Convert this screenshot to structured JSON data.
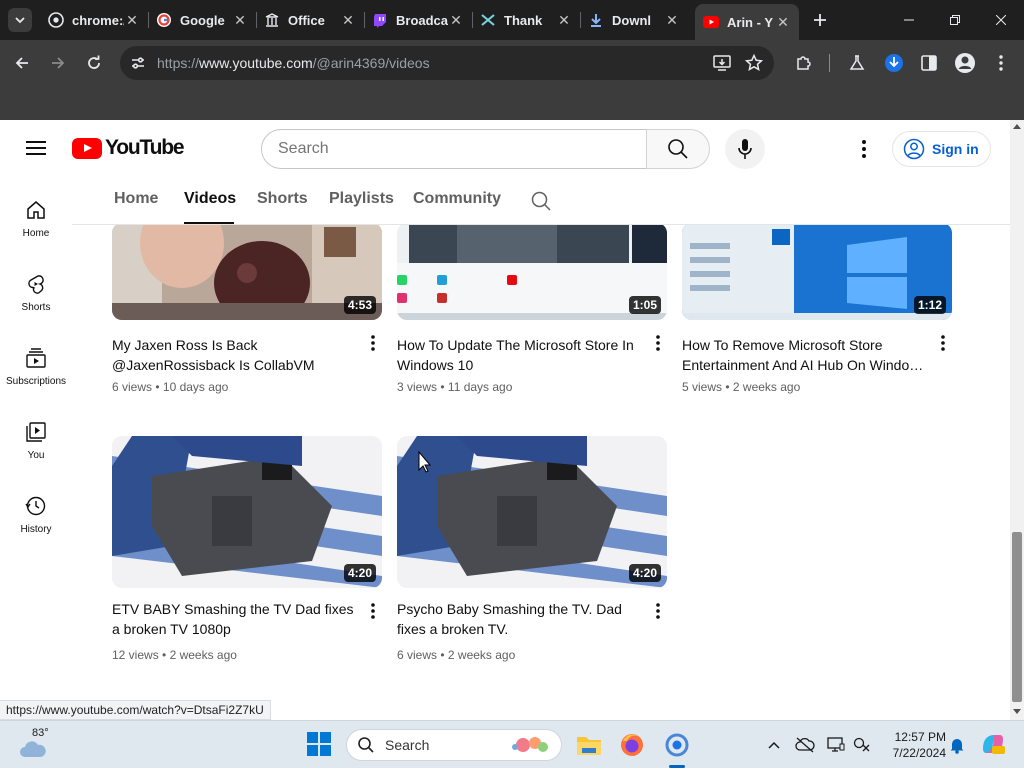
{
  "browser": {
    "tabs": [
      {
        "title": "chrome://",
        "favicon": "chrome-icon"
      },
      {
        "title": "Google",
        "favicon": "google-icon"
      },
      {
        "title": "Office",
        "favicon": "office-icon"
      },
      {
        "title": "Broadcast",
        "favicon": "twitch-icon"
      },
      {
        "title": "Thank",
        "favicon": "tutanota-icon"
      },
      {
        "title": "Downl",
        "favicon": "download-icon"
      },
      {
        "title": "Arin - Y",
        "favicon": "youtube-icon"
      }
    ],
    "url_prefix": "https://",
    "url_host": "www.youtube.com",
    "url_path": "/@arin4369/videos"
  },
  "youtube": {
    "logo_text": "YouTube",
    "search_placeholder": "Search",
    "signin_label": "Sign in",
    "sidenav": [
      {
        "label": "Home",
        "icon": "home-icon"
      },
      {
        "label": "Shorts",
        "icon": "shorts-icon"
      },
      {
        "label": "Subscriptions",
        "icon": "subscriptions-icon"
      },
      {
        "label": "You",
        "icon": "you-icon"
      },
      {
        "label": "History",
        "icon": "history-icon"
      }
    ],
    "channel_tabs": [
      "Home",
      "Videos",
      "Shorts",
      "Playlists",
      "Community"
    ],
    "active_tab": "Videos",
    "videos": [
      {
        "title": "My Jaxen Ross Is Back @JaxenRossisback Is CollabVM",
        "views": "6 views",
        "age": "10 days ago",
        "duration": "4:53"
      },
      {
        "title": "How To Update The Microsoft Store In Windows 10",
        "views": "3 views",
        "age": "11 days ago",
        "duration": "1:05"
      },
      {
        "title": "How To Remove Microsoft Store Entertainment And AI Hub On Windo…",
        "views": "5 views",
        "age": "2 weeks ago",
        "duration": "1:12"
      },
      {
        "title": "ETV BABY Smashing the TV Dad fixes a broken TV 1080p",
        "views": "12 views",
        "age": "2 weeks ago",
        "duration": "4:20"
      },
      {
        "title": "Psycho Baby Smashing the TV. Dad fixes a broken TV.",
        "views": "6 views",
        "age": "2 weeks ago",
        "duration": "4:20"
      }
    ],
    "meta_separator": "•"
  },
  "status_url": "https://www.youtube.com/watch?v=DtsaFi2Z7kU",
  "taskbar": {
    "temperature": "83°",
    "search_label": "Search",
    "time": "12:57 PM",
    "date": "7/22/2024"
  }
}
